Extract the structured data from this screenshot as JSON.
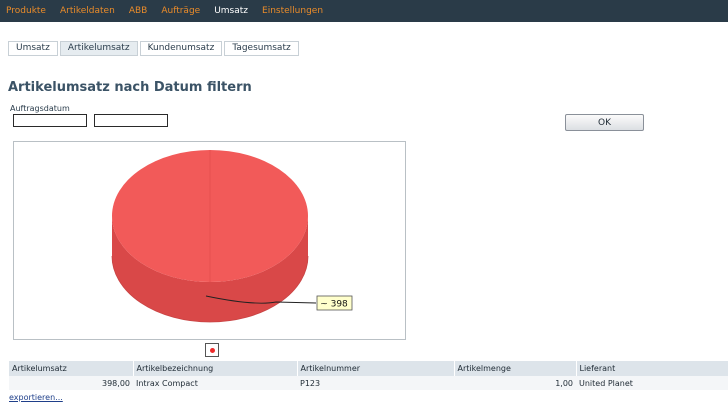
{
  "nav": {
    "items": [
      "Produkte",
      "Artikeldaten",
      "ABB",
      "Aufträge",
      "Umsatz",
      "Einstellungen"
    ],
    "active_index": 4
  },
  "subtabs": {
    "items": [
      "Umsatz",
      "Artikelumsatz",
      "Kundenumsatz",
      "Tagesumsatz"
    ],
    "active_index": 1
  },
  "filter": {
    "title": "Artikelumsatz nach Datum filtern",
    "date_label": "Auftragsdatum",
    "date_from_value": "",
    "date_to_value": "",
    "ok_label": "OK"
  },
  "chart_data": {
    "type": "pie",
    "slices": [
      {
        "label": "398",
        "value": 398,
        "color": "#f25a59"
      }
    ],
    "data_labels": [
      "~ 398"
    ],
    "legend": [
      "●"
    ],
    "colors": {
      "slice": "#f25a59",
      "slice_side": "#d94848",
      "label_bg": "#ffffcc"
    }
  },
  "table": {
    "headers": [
      "Artikelumsatz",
      "Artikelbezeichnung",
      "Artikelnummer",
      "Artikelmenge",
      "Lieferant"
    ],
    "rows": [
      [
        "398,00",
        "Intrax Compact",
        "P123",
        "1,00",
        "United Planet"
      ]
    ]
  },
  "export_label": "exportieren..."
}
